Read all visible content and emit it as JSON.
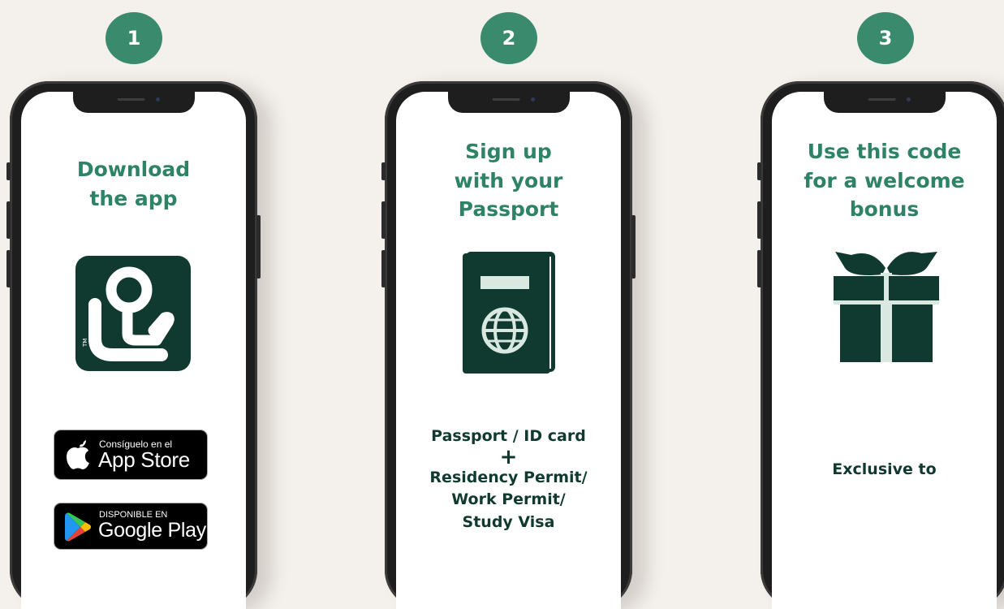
{
  "steps": [
    {
      "number": "1",
      "title": "Download\nthe app",
      "app_icon": "app-logo-icon",
      "app_store": {
        "small": "Consíguelo en el",
        "big": "App Store"
      },
      "google_play": {
        "small": "DISPONIBLE EN",
        "big": "Google Play"
      }
    },
    {
      "number": "2",
      "title": "Sign up\nwith your\nPassport",
      "icon": "passport-icon",
      "requirements": {
        "line1": "Passport / ID card",
        "plus": "+",
        "line2": "Residency Permit/",
        "line3": "Work Permit/",
        "line4": "Study Visa"
      }
    },
    {
      "number": "3",
      "title": "Use this code\nfor a welcome\nbonus",
      "icon": "gift-icon",
      "note": "Exclusive to"
    }
  ],
  "colors": {
    "background": "#f4f0ec",
    "badge": "#3a8a6e",
    "heading": "#2e8265",
    "dark_green": "#103a30"
  }
}
